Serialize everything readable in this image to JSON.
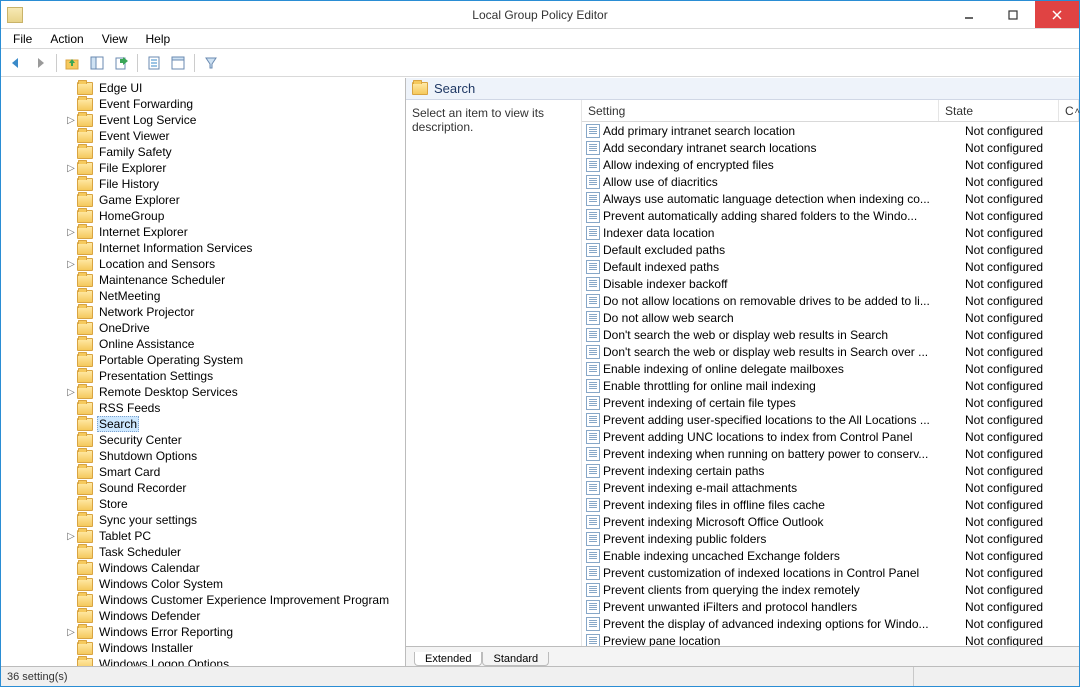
{
  "window": {
    "title": "Local Group Policy Editor"
  },
  "menu": {
    "file": "File",
    "action": "Action",
    "view": "View",
    "help": "Help"
  },
  "tree": [
    {
      "indent": 4,
      "expand": "",
      "label": "Edge UI"
    },
    {
      "indent": 4,
      "expand": "",
      "label": "Event Forwarding"
    },
    {
      "indent": 4,
      "expand": "▷",
      "label": "Event Log Service"
    },
    {
      "indent": 4,
      "expand": "",
      "label": "Event Viewer"
    },
    {
      "indent": 4,
      "expand": "",
      "label": "Family Safety"
    },
    {
      "indent": 4,
      "expand": "▷",
      "label": "File Explorer"
    },
    {
      "indent": 4,
      "expand": "",
      "label": "File History"
    },
    {
      "indent": 4,
      "expand": "",
      "label": "Game Explorer"
    },
    {
      "indent": 4,
      "expand": "",
      "label": "HomeGroup"
    },
    {
      "indent": 4,
      "expand": "▷",
      "label": "Internet Explorer"
    },
    {
      "indent": 4,
      "expand": "",
      "label": "Internet Information Services"
    },
    {
      "indent": 4,
      "expand": "▷",
      "label": "Location and Sensors"
    },
    {
      "indent": 4,
      "expand": "",
      "label": "Maintenance Scheduler"
    },
    {
      "indent": 4,
      "expand": "",
      "label": "NetMeeting"
    },
    {
      "indent": 4,
      "expand": "",
      "label": "Network Projector"
    },
    {
      "indent": 4,
      "expand": "",
      "label": "OneDrive"
    },
    {
      "indent": 4,
      "expand": "",
      "label": "Online Assistance"
    },
    {
      "indent": 4,
      "expand": "",
      "label": "Portable Operating System"
    },
    {
      "indent": 4,
      "expand": "",
      "label": "Presentation Settings"
    },
    {
      "indent": 4,
      "expand": "▷",
      "label": "Remote Desktop Services"
    },
    {
      "indent": 4,
      "expand": "",
      "label": "RSS Feeds"
    },
    {
      "indent": 4,
      "expand": "",
      "label": "Search",
      "selected": true
    },
    {
      "indent": 4,
      "expand": "",
      "label": "Security Center"
    },
    {
      "indent": 4,
      "expand": "",
      "label": "Shutdown Options"
    },
    {
      "indent": 4,
      "expand": "",
      "label": "Smart Card"
    },
    {
      "indent": 4,
      "expand": "",
      "label": "Sound Recorder"
    },
    {
      "indent": 4,
      "expand": "",
      "label": "Store"
    },
    {
      "indent": 4,
      "expand": "",
      "label": "Sync your settings"
    },
    {
      "indent": 4,
      "expand": "▷",
      "label": "Tablet PC"
    },
    {
      "indent": 4,
      "expand": "",
      "label": "Task Scheduler"
    },
    {
      "indent": 4,
      "expand": "",
      "label": "Windows Calendar"
    },
    {
      "indent": 4,
      "expand": "",
      "label": "Windows Color System"
    },
    {
      "indent": 4,
      "expand": "",
      "label": "Windows Customer Experience Improvement Program"
    },
    {
      "indent": 4,
      "expand": "",
      "label": "Windows Defender"
    },
    {
      "indent": 4,
      "expand": "▷",
      "label": "Windows Error Reporting"
    },
    {
      "indent": 4,
      "expand": "",
      "label": "Windows Installer"
    },
    {
      "indent": 4,
      "expand": "",
      "label": "Windows Logon Options"
    }
  ],
  "right": {
    "title": "Search",
    "desc": "Select an item to view its description.",
    "columns": {
      "setting": "Setting",
      "state": "State",
      "c": "C"
    }
  },
  "settings": [
    {
      "name": "Add primary intranet search location",
      "state": "Not configured"
    },
    {
      "name": "Add secondary intranet search locations",
      "state": "Not configured"
    },
    {
      "name": "Allow indexing of encrypted files",
      "state": "Not configured"
    },
    {
      "name": "Allow use of diacritics",
      "state": "Not configured"
    },
    {
      "name": "Always use automatic language detection when indexing co...",
      "state": "Not configured"
    },
    {
      "name": "Prevent automatically adding shared folders to the Windo...",
      "state": "Not configured"
    },
    {
      "name": "Indexer data location",
      "state": "Not configured"
    },
    {
      "name": "Default excluded paths",
      "state": "Not configured"
    },
    {
      "name": "Default indexed paths",
      "state": "Not configured"
    },
    {
      "name": "Disable indexer backoff",
      "state": "Not configured"
    },
    {
      "name": "Do not allow locations on removable drives to be added to li...",
      "state": "Not configured"
    },
    {
      "name": "Do not allow web search",
      "state": "Not configured"
    },
    {
      "name": "Don't search the web or display web results in Search",
      "state": "Not configured"
    },
    {
      "name": "Don't search the web or display web results in Search over ...",
      "state": "Not configured"
    },
    {
      "name": "Enable indexing of online delegate mailboxes",
      "state": "Not configured"
    },
    {
      "name": "Enable throttling for online mail indexing",
      "state": "Not configured"
    },
    {
      "name": "Prevent indexing of certain file types",
      "state": "Not configured"
    },
    {
      "name": "Prevent adding user-specified locations to the All Locations ...",
      "state": "Not configured"
    },
    {
      "name": "Prevent adding UNC locations to index from Control Panel",
      "state": "Not configured"
    },
    {
      "name": "Prevent indexing when running on battery power to conserv...",
      "state": "Not configured"
    },
    {
      "name": "Prevent indexing certain paths",
      "state": "Not configured"
    },
    {
      "name": "Prevent indexing e-mail attachments",
      "state": "Not configured"
    },
    {
      "name": "Prevent indexing files in offline files cache",
      "state": "Not configured"
    },
    {
      "name": "Prevent indexing Microsoft Office Outlook",
      "state": "Not configured"
    },
    {
      "name": "Prevent indexing public folders",
      "state": "Not configured"
    },
    {
      "name": "Enable indexing uncached Exchange folders",
      "state": "Not configured"
    },
    {
      "name": "Prevent customization of indexed locations in Control Panel",
      "state": "Not configured"
    },
    {
      "name": "Prevent clients from querying the index remotely",
      "state": "Not configured"
    },
    {
      "name": "Prevent unwanted iFilters and protocol handlers",
      "state": "Not configured"
    },
    {
      "name": "Prevent the display of advanced indexing options for Windo...",
      "state": "Not configured"
    },
    {
      "name": "Preview pane location",
      "state": "Not configured"
    }
  ],
  "tabs": {
    "extended": "Extended",
    "standard": "Standard"
  },
  "status": {
    "count": "36 setting(s)"
  }
}
